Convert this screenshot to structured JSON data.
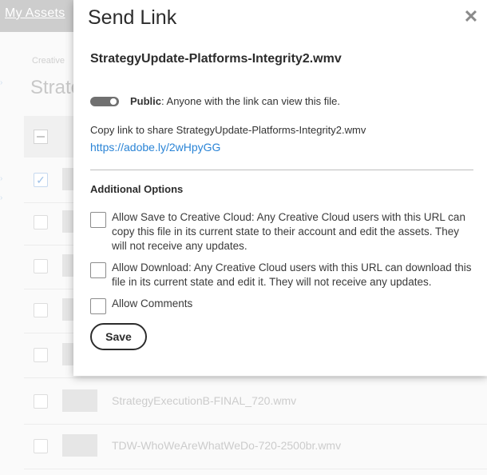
{
  "background": {
    "brand": "My Assets",
    "crumb": "Creative",
    "title": "Strate",
    "rows": [
      {
        "name": "",
        "checked": true
      },
      {
        "name": "",
        "checked": false
      },
      {
        "name": "",
        "checked": false
      },
      {
        "name": "",
        "checked": false
      },
      {
        "name": "",
        "checked": false
      },
      {
        "name": "StrategyExecutionB-FINAL_720.wmv",
        "checked": false
      },
      {
        "name": "TDW-WhoWeAreWhatWeDo-720-2500br.wmv",
        "checked": false
      }
    ]
  },
  "dialog": {
    "title": "Send Link",
    "close_icon": "close-icon",
    "file_name": "StrategyUpdate-Platforms-Integrity2.wmv",
    "public_toggle_on": true,
    "public_label": "Public",
    "public_desc": ": Anyone with the link can view this file.",
    "copy_label": "Copy link to share StrategyUpdate-Platforms-Integrity2.wmv",
    "share_url": "https://adobe.ly/2wHpyGG",
    "additional_options_heading": "Additional Options",
    "options": [
      {
        "label": "Allow Save to Creative Cloud: Any Creative Cloud users with this URL can copy this file in its current state to their account and edit the assets. They will not receive any updates.",
        "checked": false
      },
      {
        "label": "Allow Download: Any Creative Cloud users with this URL can download this file in its current state and edit it. They will not receive any updates.",
        "checked": false
      },
      {
        "label": "Allow Comments",
        "checked": false
      }
    ],
    "save_label": "Save"
  },
  "colors": {
    "link": "#2a84d6",
    "toggle": "#707070",
    "text": "#2c2c2c"
  }
}
